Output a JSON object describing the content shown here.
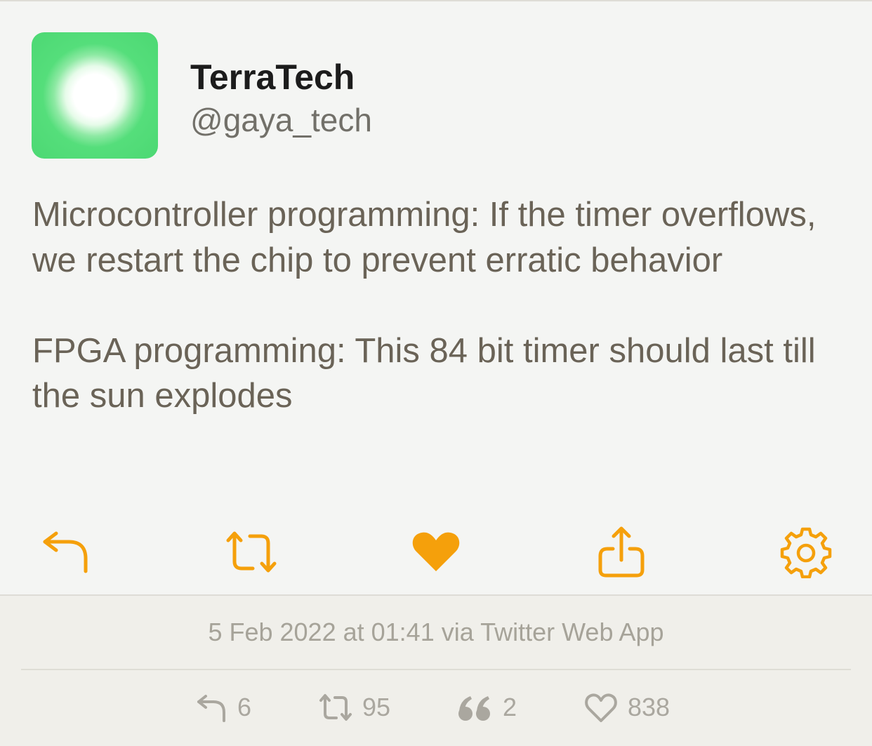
{
  "tweet": {
    "display_name": "TerraTech",
    "handle": "@gaya_tech",
    "avatar_icon": "glowing-sun-avatar",
    "paragraphs": [
      "Microcontroller programming: If the timer overflows, we restart the chip to prevent erratic behavior",
      "FPGA programming: This 84 bit timer should last till the sun explodes"
    ],
    "timestamp_line": "5 Feb 2022 at 01:41 via Twitter Web App"
  },
  "actions": [
    {
      "name": "reply-icon"
    },
    {
      "name": "retweet-icon"
    },
    {
      "name": "heart-icon",
      "state": "liked"
    },
    {
      "name": "share-icon"
    },
    {
      "name": "gear-icon"
    }
  ],
  "stats": {
    "replies": "6",
    "retweets": "95",
    "quotes": "2",
    "likes": "838"
  },
  "colors": {
    "accent": "#f5a00b",
    "card_background": "#f4f5f3",
    "footer_background": "#f0efea",
    "body_text": "#6a6357",
    "muted_text": "#a6a399"
  }
}
